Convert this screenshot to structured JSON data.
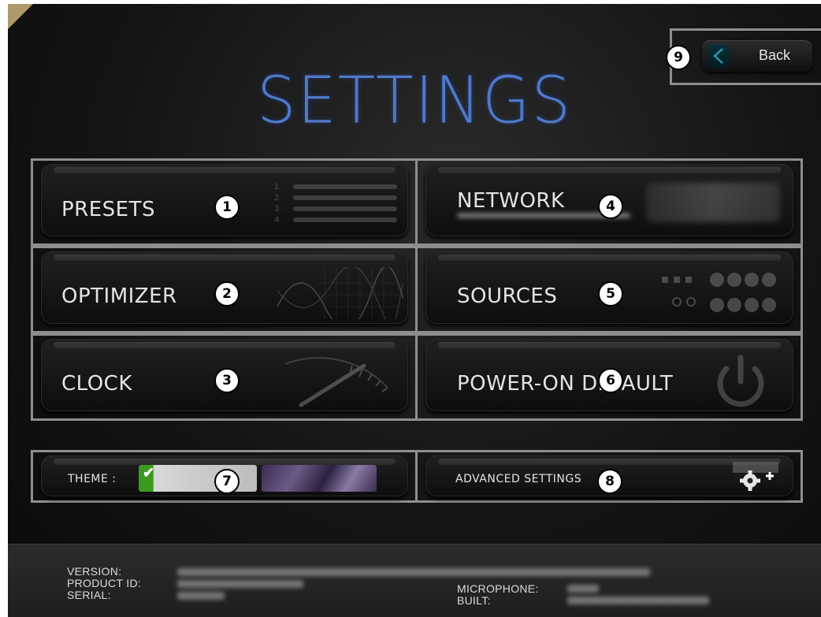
{
  "title": "SETTINGS",
  "back_button": {
    "label": "Back",
    "badge": "9"
  },
  "tiles": [
    {
      "label": "PRESETS",
      "badge": "1",
      "deco": [
        "1.",
        "2.",
        "3.",
        "4."
      ]
    },
    {
      "label": "OPTIMIZER",
      "badge": "2"
    },
    {
      "label": "CLOCK",
      "badge": "3"
    },
    {
      "label": "NETWORK",
      "badge": "4"
    },
    {
      "label": "SOURCES",
      "badge": "5"
    },
    {
      "label": "POWER-ON DEFAULT",
      "badge": "6"
    }
  ],
  "theme": {
    "label": "THEME :",
    "badge": "7",
    "check": "✔"
  },
  "advanced": {
    "label": "ADVANCED SETTINGS",
    "badge": "8"
  },
  "footer": {
    "version_label": "VERSION:",
    "product_id_label": "PRODUCT ID:",
    "serial_label": "SERIAL:",
    "microphone_label": "MICROPHONE:",
    "built_label": "BUILT:"
  },
  "colors": {
    "title": "#4f79c9",
    "accent": "#1aa0b8",
    "theme_green": "#3a9a1c",
    "border": "#8e8e8e"
  },
  "icons": [
    "chevron-left-icon",
    "check-icon",
    "gear-plus-icon",
    "power-icon"
  ]
}
